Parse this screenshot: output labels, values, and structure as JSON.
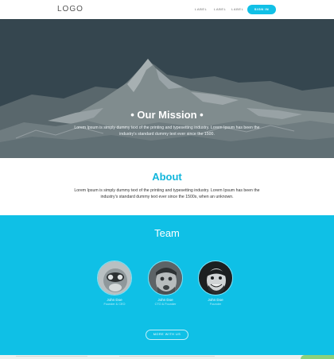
{
  "nav": {
    "logo": "LOGO",
    "links": [
      "LABEL",
      "LABEL",
      "LABEL"
    ],
    "signin": "SIGN IN"
  },
  "hero": {
    "title": "• Our Mission •",
    "text": "Lorem Ipsum is simply dummy text of the printing and typesetting industry. Lorem Ipsum has been the industry's standard dummy text ever since the 1500."
  },
  "about": {
    "title": "About",
    "text": "Lorem Ipsum is simply dummy text of the printing and typesetting industry. Lorem Ipsum has been the industry's standard dummy text ever since the 1500s, when an unknown."
  },
  "team": {
    "title": "Team",
    "members": [
      {
        "name": "John Doe",
        "role": "Founder & CEO"
      },
      {
        "name": "John Doe",
        "role": "CTO & Founder"
      },
      {
        "name": "John Doe",
        "role": "Founder"
      }
    ],
    "more_button": "MORE WITH US"
  },
  "colors": {
    "accent": "#11c0e6",
    "team_bg": "#0fc0e6",
    "about_title": "#11b6dc",
    "hero_overlay": "#3a4c56"
  }
}
